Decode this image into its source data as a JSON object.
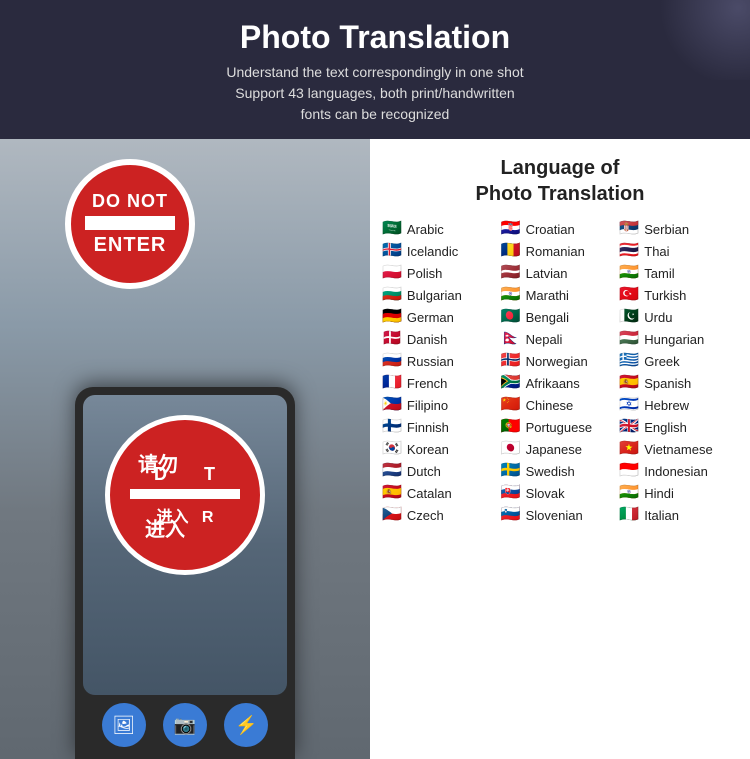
{
  "header": {
    "title": "Photo Translation",
    "subtitle_line1": "Understand the text correspondingly in one shot",
    "subtitle_line2": "Support 43 languages, both print/handwritten",
    "subtitle_line3": "fonts can be recognized"
  },
  "language_section": {
    "title_line1": "Language of",
    "title_line2": "Photo Translation"
  },
  "phone": {
    "sign_text1": "D请勿T",
    "sign_text2": "进入R",
    "buttons": [
      "🖼",
      "📷",
      "⚡"
    ]
  },
  "do_not_enter_sign": {
    "do_not": "DO NOT",
    "enter": "ENTER"
  },
  "languages": {
    "col1": [
      {
        "flag": "🇸🇦",
        "name": "Arabic"
      },
      {
        "flag": "🇮🇸",
        "name": "Icelandic"
      },
      {
        "flag": "🇵🇱",
        "name": "Polish"
      },
      {
        "flag": "🇧🇬",
        "name": "Bulgarian"
      },
      {
        "flag": "🇩🇪",
        "name": "German"
      },
      {
        "flag": "🇩🇰",
        "name": "Danish"
      },
      {
        "flag": "🇷🇺",
        "name": "Russian"
      },
      {
        "flag": "🇫🇷",
        "name": "French"
      },
      {
        "flag": "🇵🇭",
        "name": "Filipino"
      },
      {
        "flag": "🇫🇮",
        "name": "Finnish"
      },
      {
        "flag": "🇰🇷",
        "name": "Korean"
      },
      {
        "flag": "🇳🇱",
        "name": "Dutch"
      },
      {
        "flag": "🇪🇸",
        "name": "Catalan"
      },
      {
        "flag": "🇨🇿",
        "name": "Czech"
      }
    ],
    "col2": [
      {
        "flag": "🇭🇷",
        "name": "Croatian"
      },
      {
        "flag": "🇷🇴",
        "name": "Romanian"
      },
      {
        "flag": "🇱🇻",
        "name": "Latvian"
      },
      {
        "flag": "🇮🇳",
        "name": "Marathi"
      },
      {
        "flag": "🇧🇩",
        "name": "Bengali"
      },
      {
        "flag": "🇳🇵",
        "name": "Nepali"
      },
      {
        "flag": "🇳🇴",
        "name": "Norwegian"
      },
      {
        "flag": "🇿🇦",
        "name": "Afrikaans"
      },
      {
        "flag": "🇨🇳",
        "name": "Chinese"
      },
      {
        "flag": "🇵🇹",
        "name": "Portuguese"
      },
      {
        "flag": "🇯🇵",
        "name": "Japanese"
      },
      {
        "flag": "🇸🇪",
        "name": "Swedish"
      },
      {
        "flag": "🇸🇰",
        "name": "Slovak"
      },
      {
        "flag": "🇸🇮",
        "name": "Slovenian"
      }
    ],
    "col3": [
      {
        "flag": "🇷🇸",
        "name": "Serbian"
      },
      {
        "flag": "🇹🇭",
        "name": "Thai"
      },
      {
        "flag": "🇮🇳",
        "name": "Tamil"
      },
      {
        "flag": "🇹🇷",
        "name": "Turkish"
      },
      {
        "flag": "🇵🇰",
        "name": "Urdu"
      },
      {
        "flag": "🇭🇺",
        "name": "Hungarian"
      },
      {
        "flag": "🇬🇷",
        "name": "Greek"
      },
      {
        "flag": "🇪🇸",
        "name": "Spanish"
      },
      {
        "flag": "🇮🇱",
        "name": "Hebrew"
      },
      {
        "flag": "🇬🇧",
        "name": "English"
      },
      {
        "flag": "🇻🇳",
        "name": "Vietnamese"
      },
      {
        "flag": "🇮🇩",
        "name": "Indonesian"
      },
      {
        "flag": "🇮🇳",
        "name": "Hindi"
      },
      {
        "flag": "🇮🇹",
        "name": "Italian"
      }
    ]
  }
}
